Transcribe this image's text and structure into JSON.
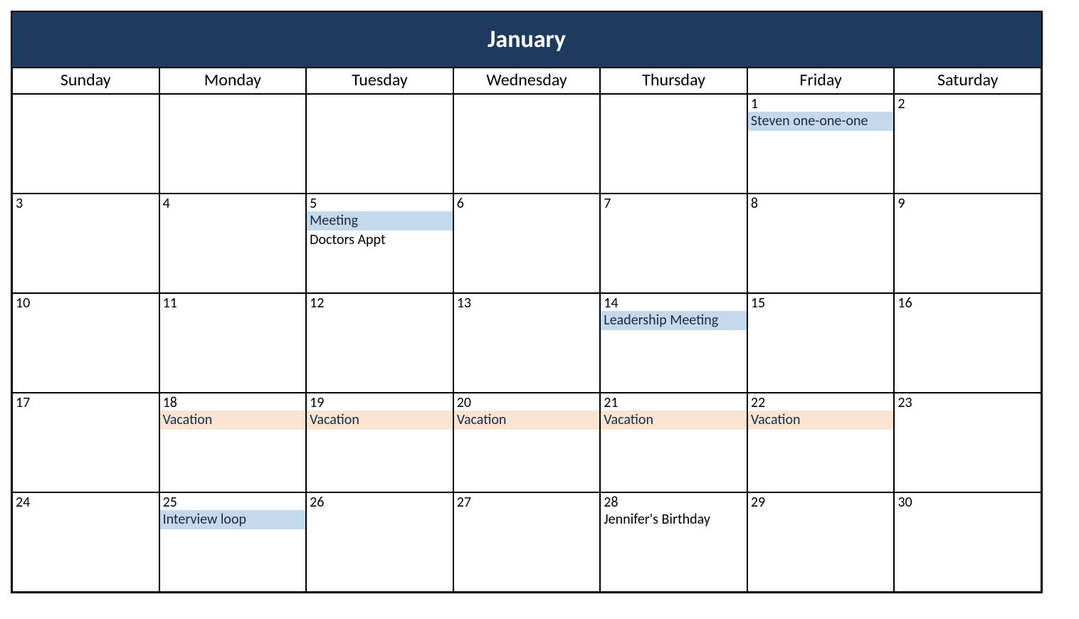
{
  "month_title": "January",
  "day_names": [
    "Sunday",
    "Monday",
    "Tuesday",
    "Wednesday",
    "Thursday",
    "Friday",
    "Saturday"
  ],
  "weeks": [
    [
      {
        "num": "",
        "events": []
      },
      {
        "num": "",
        "events": []
      },
      {
        "num": "",
        "events": []
      },
      {
        "num": "",
        "events": []
      },
      {
        "num": "",
        "events": []
      },
      {
        "num": "1",
        "events": [
          {
            "text": "Steven one-one-one",
            "color": "blue"
          }
        ]
      },
      {
        "num": "2",
        "events": []
      }
    ],
    [
      {
        "num": "3",
        "events": []
      },
      {
        "num": "4",
        "events": []
      },
      {
        "num": "5",
        "events": [
          {
            "text": "Meeting",
            "color": "blue"
          },
          {
            "text": "Doctors Appt",
            "color": "plain"
          }
        ]
      },
      {
        "num": "6",
        "events": []
      },
      {
        "num": "7",
        "events": []
      },
      {
        "num": "8",
        "events": []
      },
      {
        "num": "9",
        "events": []
      }
    ],
    [
      {
        "num": "10",
        "events": []
      },
      {
        "num": "11",
        "events": []
      },
      {
        "num": "12",
        "events": []
      },
      {
        "num": "13",
        "events": []
      },
      {
        "num": "14",
        "events": [
          {
            "text": "Leadership Meeting",
            "color": "blue"
          }
        ]
      },
      {
        "num": "15",
        "events": []
      },
      {
        "num": "16",
        "events": []
      }
    ],
    [
      {
        "num": "17",
        "events": []
      },
      {
        "num": "18",
        "events": [
          {
            "text": "Vacation",
            "color": "peach"
          }
        ]
      },
      {
        "num": "19",
        "events": [
          {
            "text": "Vacation",
            "color": "peach"
          }
        ]
      },
      {
        "num": "20",
        "events": [
          {
            "text": "Vacation",
            "color": "peach"
          }
        ]
      },
      {
        "num": "21",
        "events": [
          {
            "text": "Vacation",
            "color": "peach"
          }
        ]
      },
      {
        "num": "22",
        "events": [
          {
            "text": "Vacation",
            "color": "peach"
          }
        ]
      },
      {
        "num": "23",
        "events": []
      }
    ],
    [
      {
        "num": "24",
        "events": []
      },
      {
        "num": "25",
        "events": [
          {
            "text": "Interview loop",
            "color": "blue"
          }
        ]
      },
      {
        "num": "26",
        "events": []
      },
      {
        "num": "27",
        "events": []
      },
      {
        "num": "28",
        "events": [
          {
            "text": "Jennifer's Birthday",
            "color": "plain"
          }
        ]
      },
      {
        "num": "29",
        "events": []
      },
      {
        "num": "30",
        "events": []
      }
    ]
  ],
  "colors": {
    "header_bg": "#1f3a5f",
    "event_blue": "#c5d9ed",
    "event_peach": "#fce4d2"
  }
}
